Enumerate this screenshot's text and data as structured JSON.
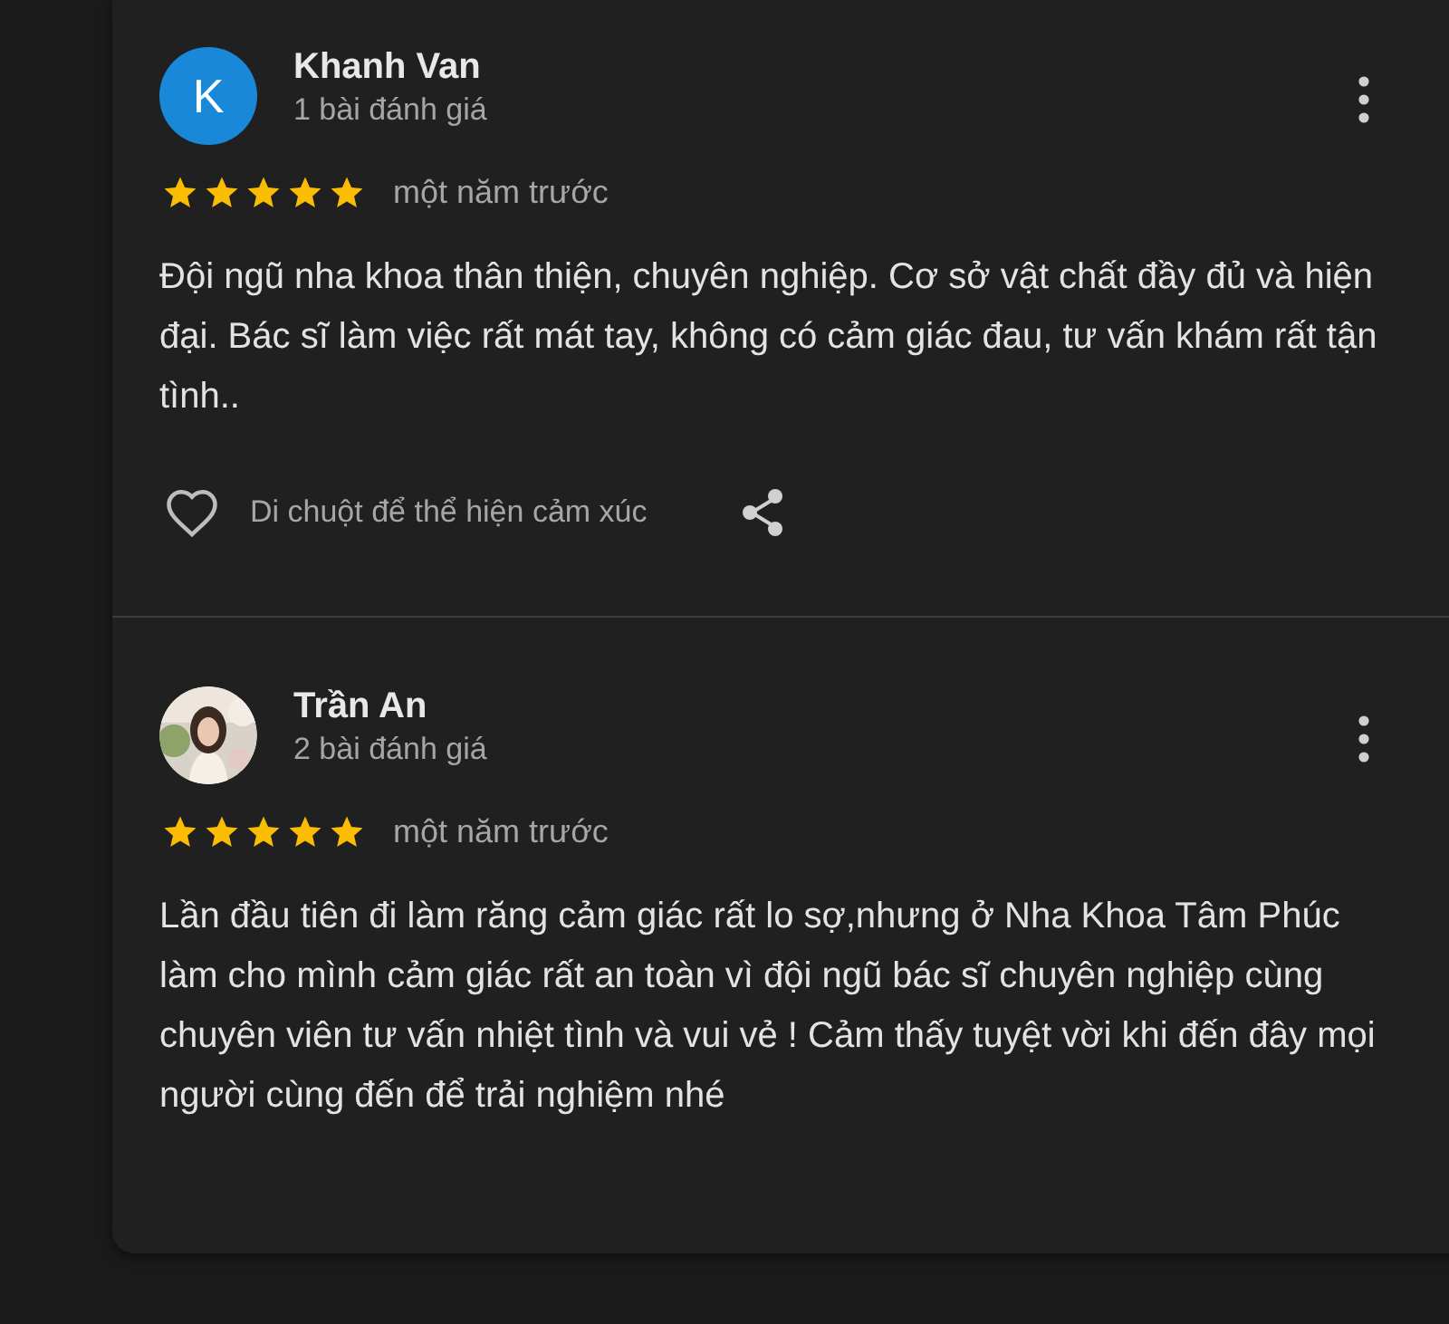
{
  "reviews": [
    {
      "author": "Khanh Van",
      "review_count": "1 bài đánh giá",
      "avatar": {
        "kind": "letter",
        "letter": "K"
      },
      "stars": 5,
      "time": "một năm trước",
      "text": "Đội ngũ nha khoa thân thiện, chuyên nghiệp. Cơ sở vật chất đầy đủ và hiện đại. Bác sĩ làm việc rất mát tay, không có cảm giác đau, tư vấn khám rất tận tình..",
      "reaction_hint": "Di chuột để thể hiện cảm xúc"
    },
    {
      "author": "Trần An",
      "review_count": "2 bài đánh giá",
      "stars": 5,
      "time": "một năm trước",
      "text": "Lần đầu tiên đi làm răng cảm giác rất lo sợ,nhưng ở Nha Khoa Tâm Phúc làm cho mình cảm giác rất an toàn vì đội ngũ bác sĩ chuyên nghiệp cùng chuyên viên tư vấn nhiệt tình và vui vẻ ! Cảm thấy tuyệt vời khi đến đây mọi người cùng đến để trải nghiệm nhé"
    }
  ]
}
